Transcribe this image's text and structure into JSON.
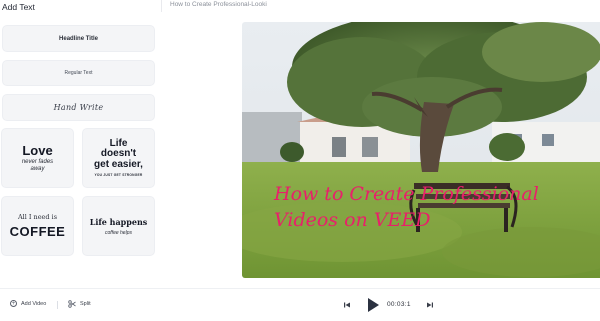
{
  "left_panel": {
    "title": "Add Text",
    "presets": {
      "headline": "Headline Title",
      "regular": "Regular Text",
      "hand": "Hand Write",
      "love": {
        "main": "Love",
        "sub1": "never fades",
        "sub2": "away"
      },
      "life1": {
        "line1": "Life",
        "line2": "doesn't",
        "line3": "get easier,",
        "sub": "YOU JUST GET STRONGER"
      },
      "coffee": {
        "top": "All I need is",
        "main": "COFFEE"
      },
      "life2": {
        "main": "Life happens",
        "sub": "coffee helps"
      }
    }
  },
  "header": {
    "project_title": "How to Create Professional-Looki"
  },
  "video": {
    "overlay_line1": "How to Create Professional",
    "overlay_line2": "Videos on VEED",
    "overlay_color": "#e8206a"
  },
  "bottom_bar": {
    "add_video_label": "Add Video",
    "split_label": "Split",
    "timecode": "00:03:1"
  }
}
